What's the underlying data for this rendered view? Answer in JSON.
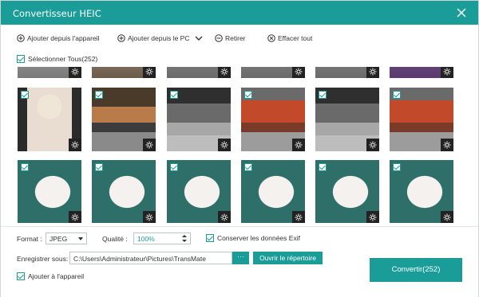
{
  "window": {
    "title": "Convertisseur HEIC"
  },
  "toolbar": {
    "add_from_device": "Ajouter depuis l'appareil",
    "add_from_pc": "Ajouter depuis le PC",
    "remove": "Retirer",
    "clear_all": "Effacer tout"
  },
  "select_all": {
    "label": "Sélectionner Tous(252)",
    "checked": true
  },
  "thumbnails": {
    "rows": [
      [
        "img-top1",
        "img-top2",
        "img-top3",
        "img-top3",
        "img-top3",
        "img-top4"
      ],
      [
        "img-doll",
        "img-moto",
        "img-moto2",
        "img-carriage",
        "img-moto2",
        "img-carriage"
      ],
      [
        "img-cat",
        "img-cat",
        "img-cat",
        "img-cat",
        "img-cat",
        "img-cat"
      ]
    ]
  },
  "settings": {
    "format_label": "Format :",
    "format_value": "JPEG",
    "quality_label": "Qualité :",
    "quality_value": "100%",
    "keep_exif_label": "Conserver les données Exif",
    "keep_exif_checked": true,
    "save_label": "Enregistrer sous:",
    "save_path": "C:\\Users\\Administrateur\\Pictures\\TransMate",
    "browse_label": "···",
    "open_folder_label": "Ouvrir le répertoire",
    "add_to_device_label": "Ajouter à l'appareil",
    "add_to_device_checked": true,
    "convert_label": "Convertir(252)"
  },
  "colors": {
    "accent": "#1a9d99"
  }
}
